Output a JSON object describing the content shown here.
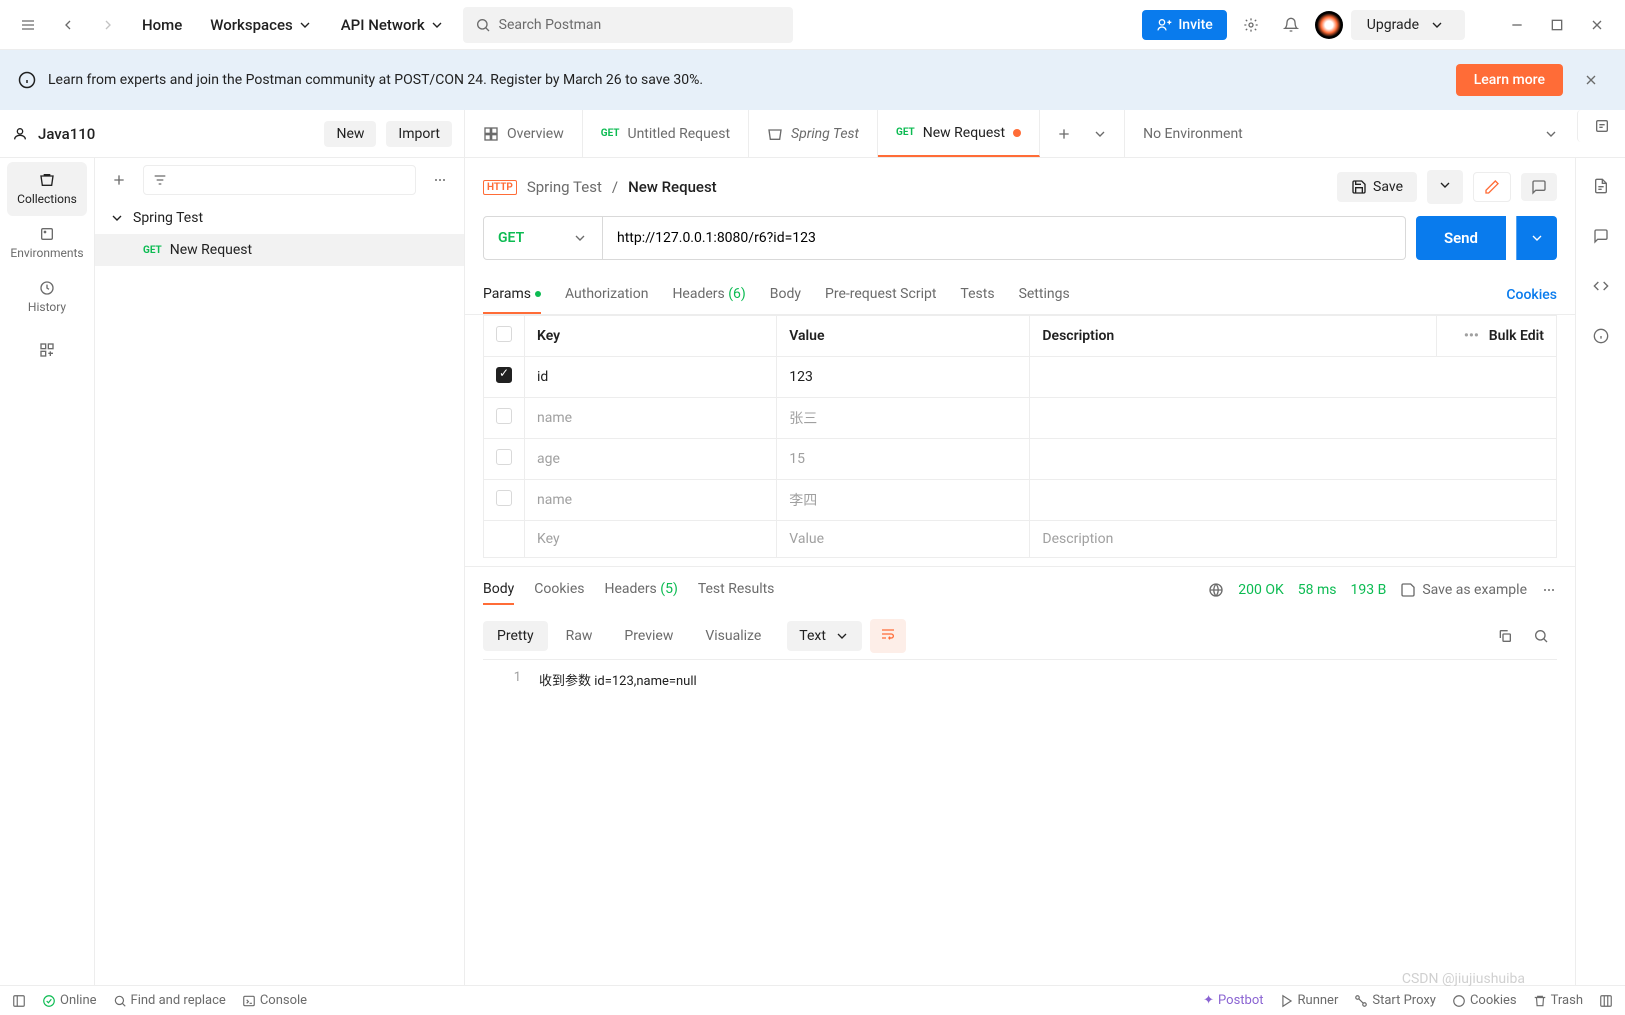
{
  "topbar": {
    "home": "Home",
    "workspaces": "Workspaces",
    "api_network": "API Network",
    "search_placeholder": "Search Postman",
    "invite": "Invite",
    "upgrade": "Upgrade"
  },
  "banner": {
    "text": "Learn from experts and join the Postman community at POST/CON 24. Register by March 26 to save 30%.",
    "cta": "Learn more"
  },
  "workspace": {
    "name": "Java110",
    "new_btn": "New",
    "import_btn": "Import"
  },
  "sidebar": {
    "items": [
      {
        "label": "Collections",
        "active": true
      },
      {
        "label": "Environments",
        "active": false
      },
      {
        "label": "History",
        "active": false
      }
    ]
  },
  "tree": {
    "collection": "Spring Test",
    "request_method": "GET",
    "request_name": "New Request"
  },
  "tabs": [
    {
      "label": "Overview",
      "type": "overview"
    },
    {
      "label": "Untitled Request",
      "type": "request",
      "method": "GET"
    },
    {
      "label": "Spring Test",
      "type": "collection"
    },
    {
      "label": "New Request",
      "type": "request",
      "method": "GET",
      "active": true,
      "dirty": true
    }
  ],
  "environment": "No Environment",
  "breadcrumb": {
    "parent": "Spring Test",
    "current": "New Request",
    "save": "Save"
  },
  "request": {
    "method": "GET",
    "url": "http://127.0.0.1:8080/r6?id=123",
    "send": "Send"
  },
  "req_tabs": {
    "params": "Params",
    "auth": "Authorization",
    "headers": "Headers",
    "headers_count": "(6)",
    "body": "Body",
    "prerequest": "Pre-request Script",
    "tests": "Tests",
    "settings": "Settings",
    "cookies": "Cookies"
  },
  "params_table": {
    "headers": {
      "key": "Key",
      "value": "Value",
      "description": "Description",
      "bulk": "Bulk Edit"
    },
    "rows": [
      {
        "checked": true,
        "key": "id",
        "value": "123",
        "desc": ""
      },
      {
        "checked": false,
        "key": "name",
        "value": "张三",
        "desc": "",
        "placeholder": true
      },
      {
        "checked": false,
        "key": "age",
        "value": "15",
        "desc": "",
        "placeholder": true
      },
      {
        "checked": false,
        "key": "name",
        "value": "李四",
        "desc": "",
        "placeholder": true
      }
    ],
    "empty": {
      "key": "Key",
      "value": "Value",
      "desc": "Description"
    }
  },
  "response": {
    "tabs": {
      "body": "Body",
      "cookies": "Cookies",
      "headers": "Headers",
      "headers_count": "(5)",
      "test_results": "Test Results"
    },
    "status": "200 OK",
    "time": "58 ms",
    "size": "193 B",
    "save_example": "Save as example",
    "view_tabs": {
      "pretty": "Pretty",
      "raw": "Raw",
      "preview": "Preview",
      "visualize": "Visualize"
    },
    "format": "Text",
    "body_lines": [
      {
        "num": "1",
        "text": "收到参数 id=123,name=null"
      }
    ]
  },
  "statusbar": {
    "online": "Online",
    "find": "Find and replace",
    "console": "Console",
    "postbot": "Postbot",
    "runner": "Runner",
    "proxy": "Start Proxy",
    "cookies": "Cookies",
    "trash": "Trash"
  },
  "watermark": "CSDN @jiujiushuiba"
}
